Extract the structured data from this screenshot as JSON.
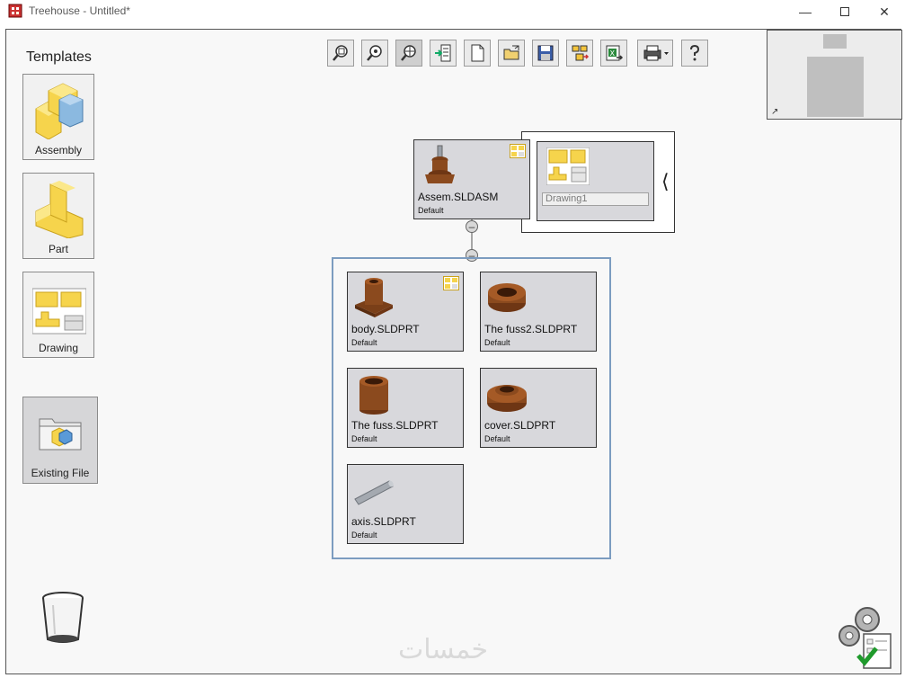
{
  "window": {
    "title": "Treehouse - Untitled*",
    "controls": [
      "minimize-icon",
      "maximize-icon",
      "close-icon"
    ]
  },
  "toolbar": {
    "buttons": [
      "zoom-region-icon",
      "zoom-fit-icon",
      "pan-zoom-icon",
      "import-icon",
      "new-document-icon",
      "open-icon",
      "save-icon",
      "convert-icon",
      "export-excel-icon",
      "print-icon",
      "help-icon"
    ]
  },
  "templates": {
    "heading": "Templates",
    "items": [
      {
        "label": "Assembly",
        "icon": "assembly-icon"
      },
      {
        "label": "Part",
        "icon": "part-icon"
      },
      {
        "label": "Drawing",
        "icon": "drawing-icon"
      }
    ],
    "existing_file_label": "Existing File"
  },
  "tree": {
    "root": {
      "name": "Assem.SLDASM",
      "config": "Default"
    },
    "drawing": {
      "field_value": "Drawing1"
    },
    "children": [
      {
        "name": "body.SLDPRT",
        "config": "Default"
      },
      {
        "name": "The fuss2.SLDPRT",
        "config": "Default"
      },
      {
        "name": "The fuss.SLDPRT",
        "config": "Default"
      },
      {
        "name": "cover.SLDPRT",
        "config": "Default"
      },
      {
        "name": "axis.SLDPRT",
        "config": "Default"
      }
    ]
  },
  "watermark": "خمسات",
  "colors": {
    "group_border": "#7c9cc0",
    "node_bg": "#d8d8dc",
    "part_brown": "#8b4a1e"
  }
}
